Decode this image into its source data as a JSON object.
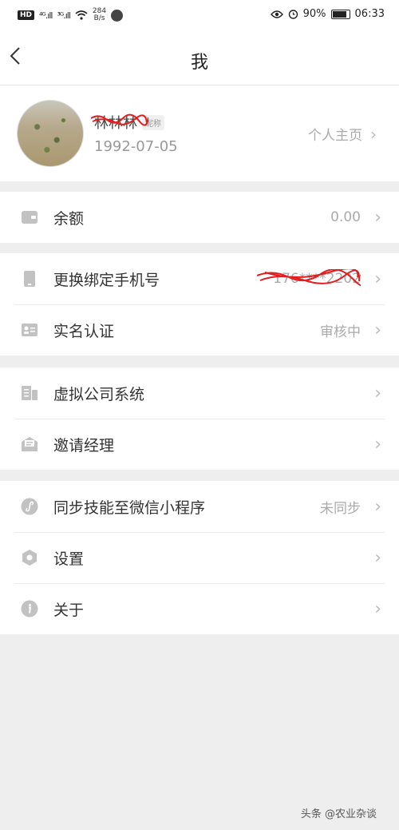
{
  "status_bar": {
    "hd": "HD",
    "signal_1": "⁴ᴳ.ıll",
    "signal_2": "³ᴳ.ıll",
    "speed_value": "284",
    "speed_unit": "B/s",
    "battery": "90%",
    "time": "06:33"
  },
  "nav": {
    "title": "我"
  },
  "profile": {
    "nickname": "林林林",
    "nickname_badge": "昵称",
    "birthday": "1992-07-05",
    "homepage_link": "个人主页"
  },
  "groups": [
    {
      "rows": [
        {
          "icon": "wallet-icon",
          "label": "余额",
          "value": "0.00"
        }
      ]
    },
    {
      "rows": [
        {
          "icon": "phone-icon",
          "label": "更换绑定手机号",
          "value": "176****2202"
        },
        {
          "icon": "id-card-icon",
          "label": "实名认证",
          "value": "审核中"
        }
      ]
    },
    {
      "rows": [
        {
          "icon": "company-icon",
          "label": "虚拟公司系统",
          "value": ""
        },
        {
          "icon": "invite-icon",
          "label": "邀请经理",
          "value": ""
        }
      ]
    },
    {
      "rows": [
        {
          "icon": "mini-program-icon",
          "label": "同步技能至微信小程序",
          "value": "未同步"
        },
        {
          "icon": "settings-hex-icon",
          "label": "设置",
          "value": ""
        },
        {
          "icon": "info-icon",
          "label": "关于",
          "value": ""
        }
      ]
    }
  ],
  "watermark": "头条 @农业杂谈",
  "colors": {
    "background": "#eeeeee",
    "icon_gray": "#c2c2c2",
    "text_primary": "#333333",
    "text_secondary": "#aaaaaa",
    "scribble_red": "#e02020"
  }
}
